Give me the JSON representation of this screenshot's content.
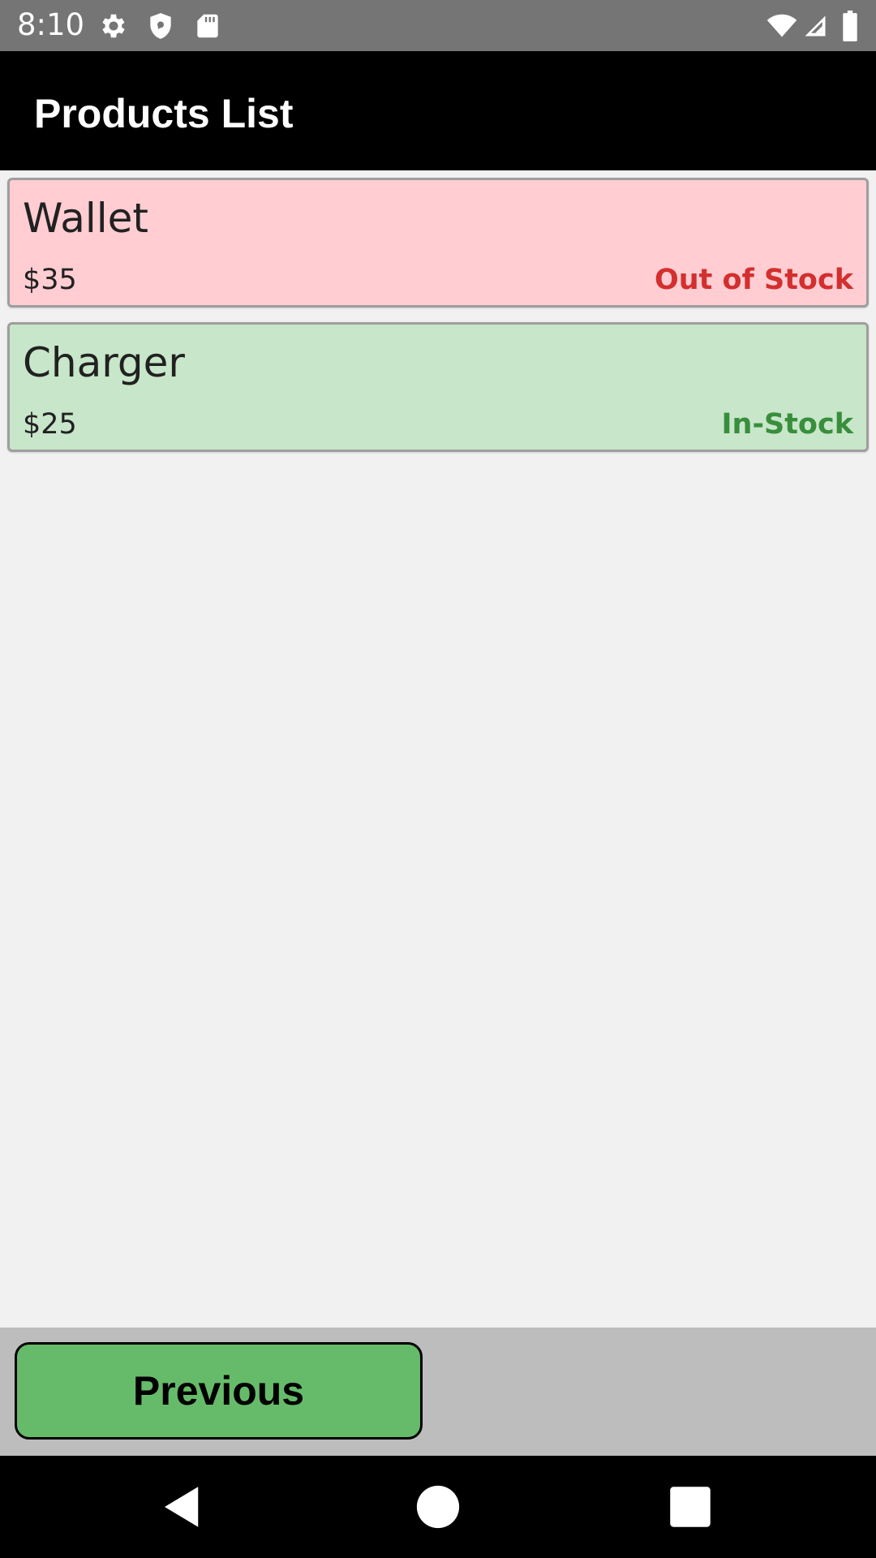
{
  "status_bar": {
    "time": "8:10",
    "left_icons": [
      "gear-icon",
      "shield-icon",
      "sd-card-icon"
    ],
    "right_icons": [
      "wifi-icon",
      "signal-icon",
      "battery-icon"
    ],
    "background": "#757575"
  },
  "app_bar": {
    "title": "Products List",
    "background": "#000000"
  },
  "products": [
    {
      "name": "Wallet",
      "price": "$35",
      "status": "Out of Stock",
      "card_color": "#ffcdd2",
      "status_color": "#d32f2f"
    },
    {
      "name": "Charger",
      "price": "$25",
      "status": "In-Stock",
      "card_color": "#c8e6c9",
      "status_color": "#388e3c"
    }
  ],
  "bottom_bar": {
    "previous_label": "Previous",
    "button_color": "#66bb6a",
    "background": "#bdbdbd"
  },
  "nav_bar": {
    "buttons": [
      "back-icon",
      "home-icon",
      "recents-icon"
    ]
  }
}
